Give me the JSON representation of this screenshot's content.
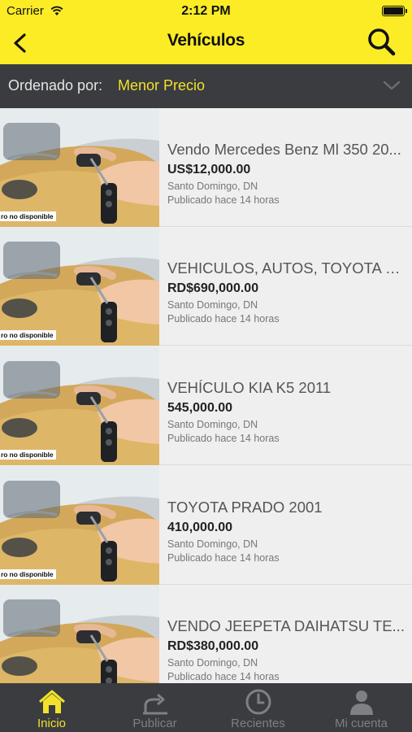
{
  "status_bar": {
    "carrier": "Carrier",
    "time": "2:12 PM"
  },
  "nav": {
    "title": "Vehículos",
    "back_icon": "back-arrow-icon",
    "search_icon": "search-icon"
  },
  "sort": {
    "label": "Ordenado por:",
    "value": "Menor Precio"
  },
  "colors": {
    "accent_yellow": "#fcec26",
    "dark_bar": "#3a3c40",
    "active_tab": "#f2e12b"
  },
  "listings": [
    {
      "title": "Vendo Mercedes Benz Ml 350 20...",
      "price": "US$12,000.00",
      "location": "Santo Domingo, DN",
      "posted": "Publicado hace 14 horas",
      "badge": "ro no disponible"
    },
    {
      "title": "VEHICULOS, AUTOS, TOYOTA CO...",
      "price": "RD$690,000.00",
      "location": "Santo Domingo, DN",
      "posted": "Publicado hace 14 horas",
      "badge": "ro no disponible"
    },
    {
      "title": "VEHÍCULO KIA K5 2011",
      "price": "545,000.00",
      "location": "Santo Domingo, DN",
      "posted": "Publicado hace 14 horas",
      "badge": "ro no disponible"
    },
    {
      "title": "TOYOTA PRADO 2001",
      "price": "410,000.00",
      "location": "Santo Domingo, DN",
      "posted": "Publicado hace 14 horas",
      "badge": "ro no disponible"
    },
    {
      "title": "VENDO JEEPETA DAIHATSU TE...",
      "price": "RD$380,000.00",
      "location": "Santo Domingo, DN",
      "posted": "Publicado hace 14 horas",
      "badge": ""
    }
  ],
  "tabs": [
    {
      "label": "Inicio",
      "icon": "home-icon",
      "active": true
    },
    {
      "label": "Publicar",
      "icon": "publish-icon",
      "active": false
    },
    {
      "label": "Recientes",
      "icon": "clock-icon",
      "active": false
    },
    {
      "label": "Mi cuenta",
      "icon": "user-icon",
      "active": false
    }
  ]
}
